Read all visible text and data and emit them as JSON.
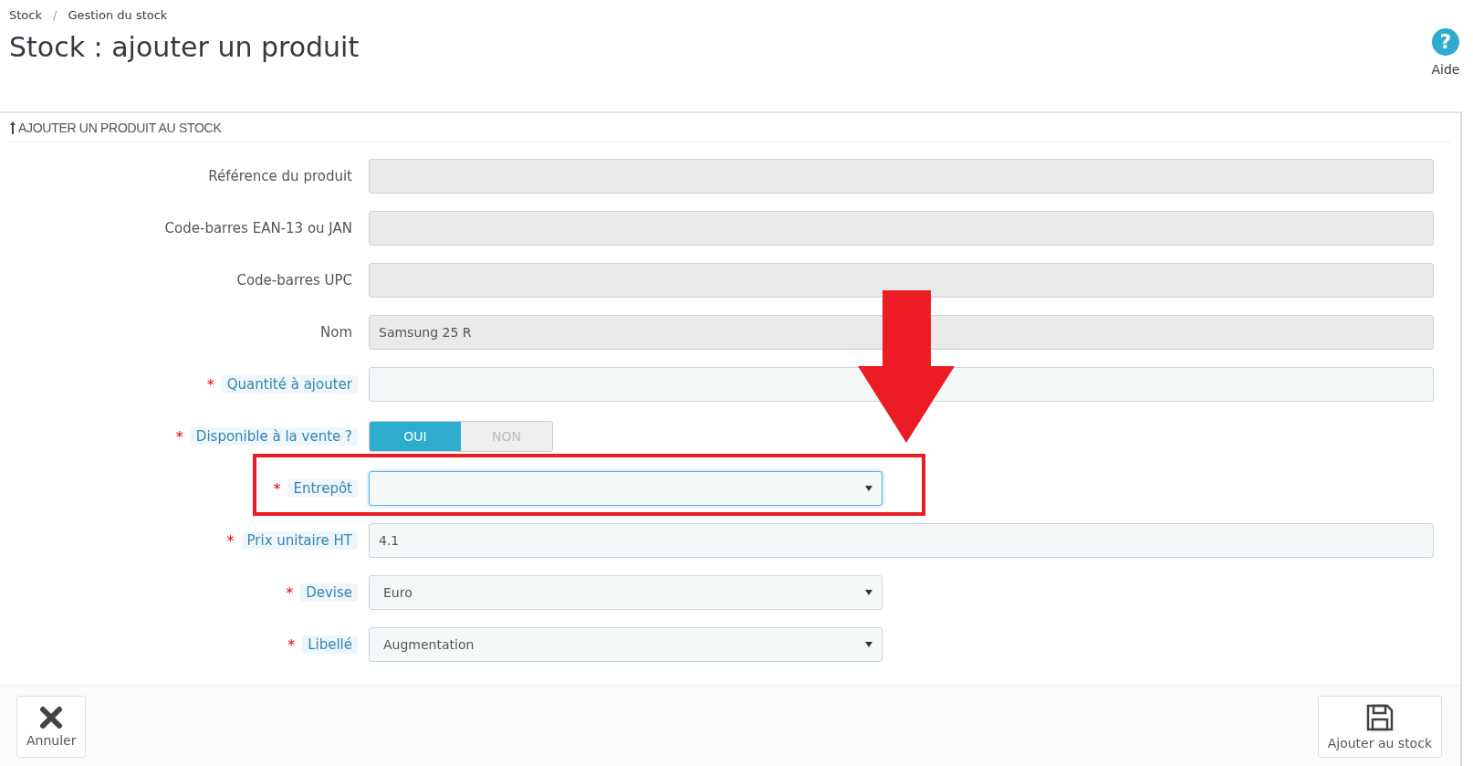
{
  "breadcrumb": [
    {
      "label": "Stock"
    },
    {
      "separator": "/",
      "label": "Gestion du stock"
    }
  ],
  "title": "Stock : ajouter un produit",
  "help": {
    "glyph": "?",
    "label": "Aide"
  },
  "panel": {
    "heading": "AJOUTER UN PRODUIT AU STOCK",
    "fields": [
      {
        "kind": "text",
        "label": "Référence du produit",
        "required": false,
        "disabled": true
      },
      {
        "kind": "text",
        "label": "Code-barres EAN-13 ou JAN",
        "required": false,
        "disabled": true
      },
      {
        "kind": "text",
        "label": "Code-barres UPC",
        "required": false,
        "disabled": true
      },
      {
        "kind": "text",
        "label": "Nom",
        "required": false,
        "disabled": true,
        "value": "Samsung 25 R"
      },
      {
        "kind": "text",
        "label": "Quantité à ajouter",
        "required": true,
        "required_mark": "*",
        "disabled": false
      },
      {
        "kind": "toggle",
        "label": "Disponible à la vente ?",
        "required": true,
        "required_mark": "*",
        "options": [
          {
            "label": "OUI",
            "selected": true
          },
          {
            "label": "NON",
            "selected": false
          }
        ]
      },
      {
        "kind": "select",
        "label": "Entrepôt",
        "required": true,
        "required_mark": "*",
        "focused": true
      },
      {
        "kind": "text",
        "label": "Prix unitaire HT",
        "required": true,
        "required_mark": "*",
        "disabled": false,
        "value": "4.1"
      },
      {
        "kind": "select",
        "label": "Devise",
        "required": true,
        "required_mark": "*",
        "focused": false,
        "value": "Euro"
      },
      {
        "kind": "select",
        "label": "Libellé",
        "required": true,
        "required_mark": "*",
        "focused": false,
        "value": "Augmentation"
      }
    ],
    "buttons": [
      {
        "kind": "cancel",
        "label": "Annuler"
      },
      {
        "kind": "save",
        "label": "Ajouter au stock"
      }
    ]
  }
}
